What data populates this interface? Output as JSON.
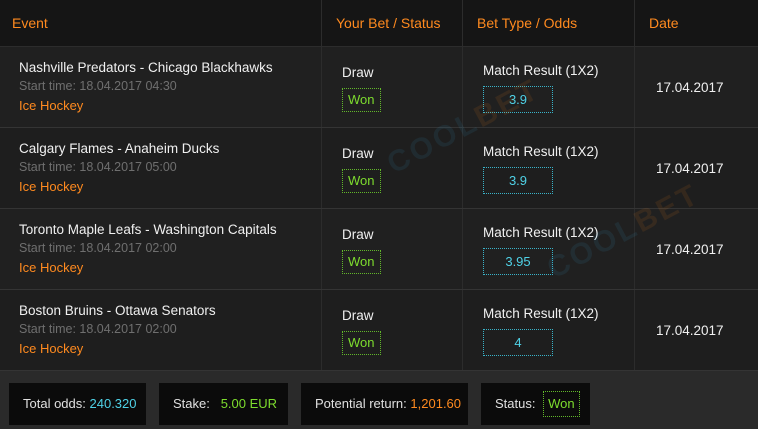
{
  "header": {
    "event": "Event",
    "bet_status": "Your Bet / Status",
    "type_odds": "Bet Type / Odds",
    "date": "Date"
  },
  "rows": [
    {
      "match": "Nashville Predators - Chicago Blackhawks",
      "start": "Start time: 18.04.2017 04:30",
      "sport": "Ice Hockey",
      "pick": "Draw",
      "status": "Won",
      "market": "Match Result (1X2)",
      "odds": "3.9",
      "date": "17.04.2017"
    },
    {
      "match": "Calgary Flames - Anaheim Ducks",
      "start": "Start time: 18.04.2017 05:00",
      "sport": "Ice Hockey",
      "pick": "Draw",
      "status": "Won",
      "market": "Match Result (1X2)",
      "odds": "3.9",
      "date": "17.04.2017"
    },
    {
      "match": "Toronto Maple Leafs - Washington Capitals",
      "start": "Start time: 18.04.2017 02:00",
      "sport": "Ice Hockey",
      "pick": "Draw",
      "status": "Won",
      "market": "Match Result (1X2)",
      "odds": "3.95",
      "date": "17.04.2017"
    },
    {
      "match": "Boston Bruins - Ottawa Senators",
      "start": "Start time: 18.04.2017 02:00",
      "sport": "Ice Hockey",
      "pick": "Draw",
      "status": "Won",
      "market": "Match Result (1X2)",
      "odds": "4",
      "date": "17.04.2017"
    }
  ],
  "footer": {
    "total_odds_label": "Total odds:",
    "total_odds_value": "240.320",
    "stake_label": "Stake:",
    "stake_value": "5.00 EUR",
    "potential_label": "Potential return:",
    "potential_value": "1,201.60",
    "status_label": "Status:",
    "status_value": "Won"
  },
  "watermark": {
    "part1": "COOL",
    "part2": "BET"
  },
  "colors": {
    "accent": "#ff8a1f",
    "won": "#7ddc2e",
    "odds": "#4fd1e6",
    "background": "#1c1c1c"
  }
}
